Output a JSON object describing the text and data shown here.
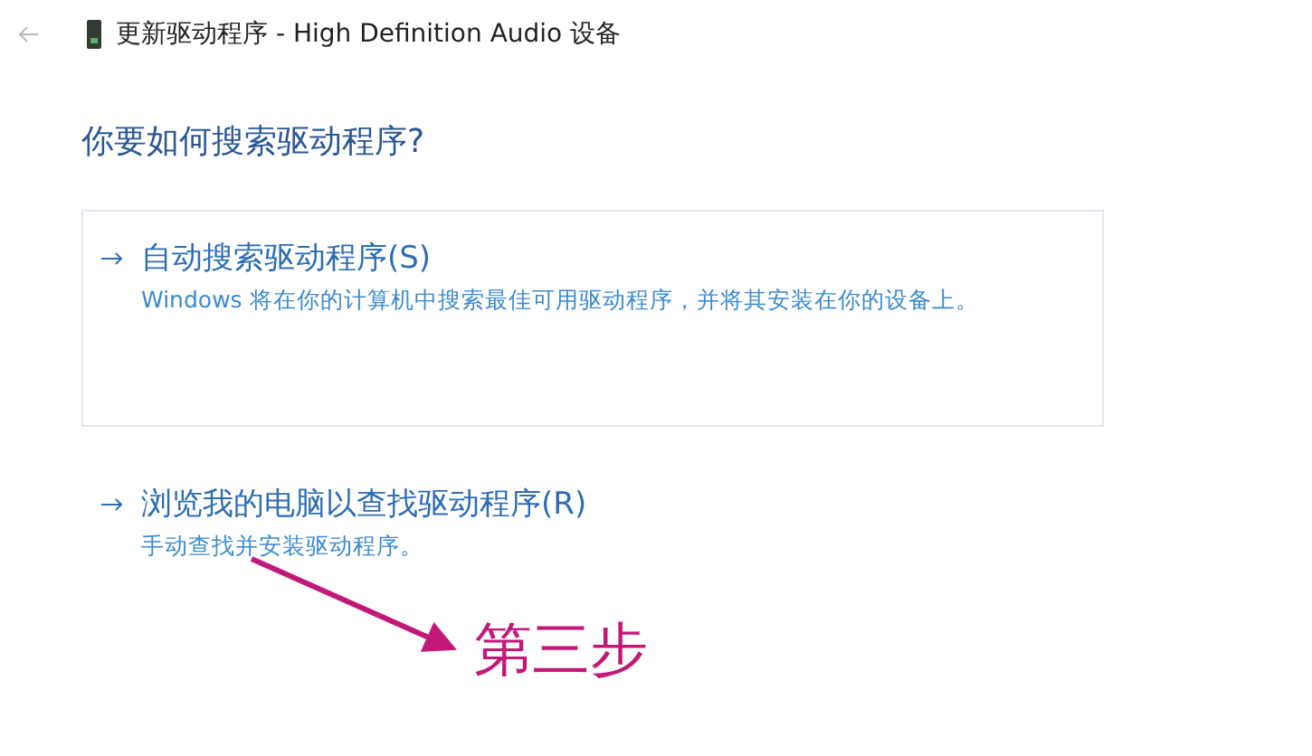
{
  "window": {
    "title": "更新驱动程序 - High Definition Audio 设备"
  },
  "heading": "你要如何搜索驱动程序?",
  "options": [
    {
      "title": "自动搜索驱动程序(S)",
      "description": "Windows 将在你的计算机中搜索最佳可用驱动程序，并将其安装在你的设备上。",
      "selected": true
    },
    {
      "title": "浏览我的电脑以查找驱动程序(R)",
      "description": "手动查找并安装驱动程序。",
      "selected": false
    }
  ],
  "annotation": {
    "text": "第三步"
  }
}
